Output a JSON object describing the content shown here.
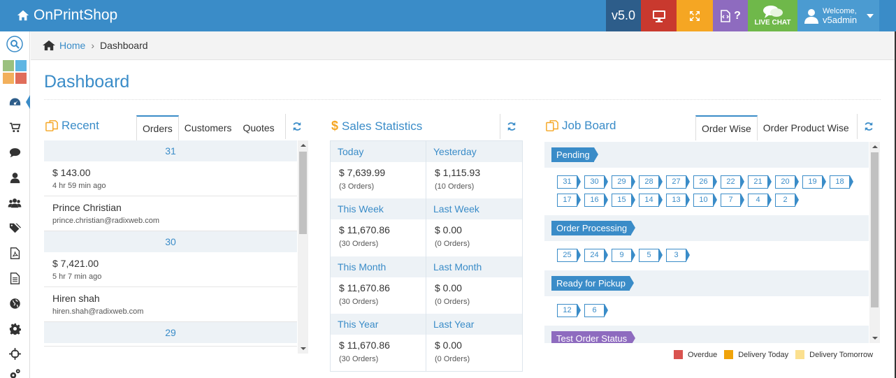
{
  "header": {
    "brand": "OnPrintShop",
    "version": "v5.0",
    "live_chat": "LIVE CHAT",
    "welcome": "Welcome,",
    "username": "v5admin"
  },
  "breadcrumb": {
    "home": "Home",
    "current": "Dashboard"
  },
  "page_title": "Dashboard",
  "recent": {
    "title": "Recent",
    "tabs": [
      "Orders",
      "Customers",
      "Quotes"
    ],
    "active_tab": "Orders",
    "groups": [
      {
        "label": "31",
        "items": [
          {
            "main": "$ 143.00",
            "sub": "4 hr 59 min ago"
          },
          {
            "main": "Prince Christian",
            "sub": "prince.christian@radixweb.com"
          }
        ]
      },
      {
        "label": "30",
        "items": [
          {
            "main": "$ 7,421.00",
            "sub": "5 hr 7 min ago"
          },
          {
            "main": "Hiren shah",
            "sub": "hiren.shah@radixweb.com"
          }
        ]
      },
      {
        "label": "29",
        "items": []
      }
    ]
  },
  "sales": {
    "title": "Sales Statistics",
    "cells": [
      {
        "label": "Today",
        "amount": "$ 7,639.99",
        "count": "(3 Orders)"
      },
      {
        "label": "Yesterday",
        "amount": "$ 1,115.93",
        "count": "(10 Orders)"
      },
      {
        "label": "This Week",
        "amount": "$ 11,670.86",
        "count": "(30 Orders)"
      },
      {
        "label": "Last Week",
        "amount": "$ 0.00",
        "count": "(0 Orders)"
      },
      {
        "label": "This Month",
        "amount": "$ 11,670.86",
        "count": "(30 Orders)"
      },
      {
        "label": "Last Month",
        "amount": "$ 0.00",
        "count": "(0 Orders)"
      },
      {
        "label": "This Year",
        "amount": "$ 11,670.86",
        "count": "(30 Orders)"
      },
      {
        "label": "Last Year",
        "amount": "$ 0.00",
        "count": "(0 Orders)"
      }
    ]
  },
  "job_board": {
    "title": "Job Board",
    "tabs": [
      "Order Wise",
      "Order Product Wise"
    ],
    "active_tab": "Order Wise",
    "sections": [
      {
        "status": "Pending",
        "color": "#3a8cc8",
        "orders": [
          "31",
          "30",
          "29",
          "28",
          "27",
          "26",
          "22",
          "21",
          "20",
          "19",
          "18",
          "17",
          "16",
          "15",
          "14",
          "13",
          "10",
          "7",
          "4",
          "2"
        ]
      },
      {
        "status": "Order Processing",
        "color": "#3a8cc8",
        "orders": [
          "25",
          "24",
          "9",
          "5",
          "3"
        ]
      },
      {
        "status": "Ready for Pickup",
        "color": "#3a8cc8",
        "orders": [
          "12",
          "6"
        ]
      },
      {
        "status": "Test Order Status",
        "color": "#8e6bbf",
        "orders": []
      }
    ],
    "legend": [
      {
        "label": "Overdue",
        "color": "#d9534f"
      },
      {
        "label": "Delivery Today",
        "color": "#f0a30a"
      },
      {
        "label": "Delivery Tomorrow",
        "color": "#fbe08f"
      }
    ]
  },
  "sidebar": {
    "items": [
      "search-icon",
      "app-tiles-icon",
      "dashboard-icon",
      "cart-icon",
      "comment-icon",
      "user-icon",
      "users-icon",
      "tags-icon",
      "pdf-icon",
      "document-icon",
      "globe-icon",
      "gear-icon",
      "crosshair-icon",
      "gears-icon"
    ]
  }
}
